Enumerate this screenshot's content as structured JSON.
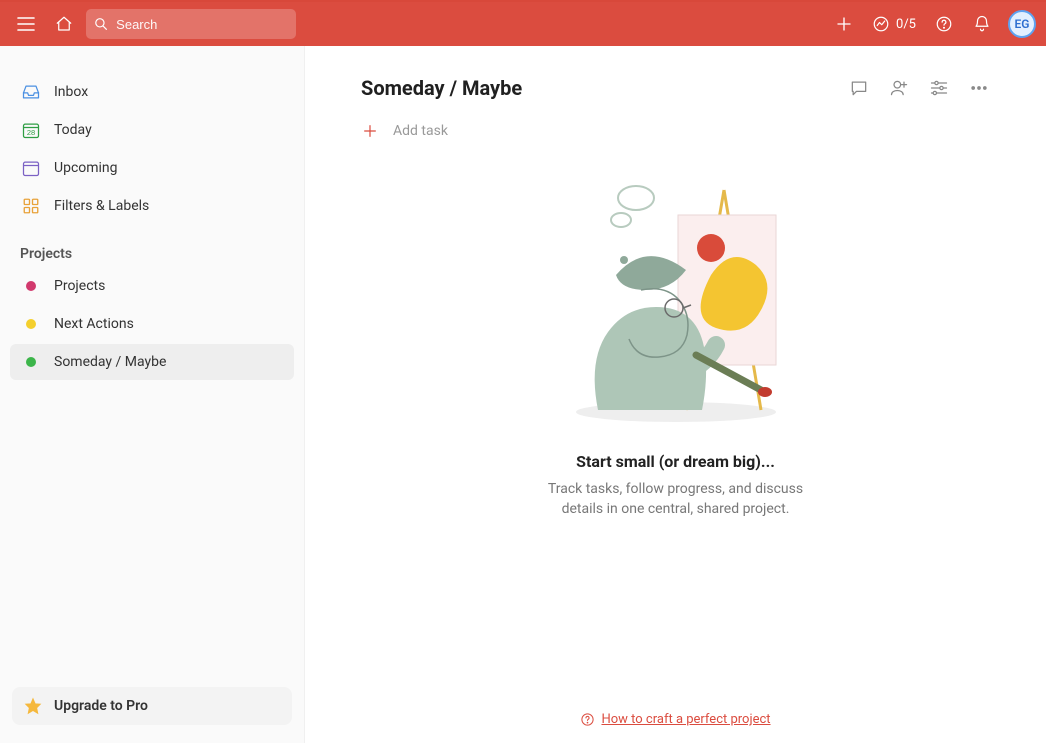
{
  "topbar": {
    "search_placeholder": "Search",
    "productivity_count": "0/5"
  },
  "avatar": {
    "initials": "EG"
  },
  "sidebar": {
    "nav": [
      {
        "label": "Inbox"
      },
      {
        "label": "Today",
        "day": "28"
      },
      {
        "label": "Upcoming"
      },
      {
        "label": "Filters & Labels"
      }
    ],
    "projects_header": "Projects",
    "projects": [
      {
        "label": "Projects",
        "color": "#d1396d"
      },
      {
        "label": "Next Actions",
        "color": "#f4cf2d"
      },
      {
        "label": "Someday / Maybe",
        "color": "#3cb54a"
      }
    ],
    "upgrade_label": "Upgrade to Pro"
  },
  "content": {
    "title": "Someday / Maybe",
    "add_task_label": "Add task",
    "empty_title": "Start small (or dream big)...",
    "empty_desc": "Track tasks, follow progress, and discuss details in one central, shared project.",
    "help_link_text": "How to craft a perfect project"
  }
}
